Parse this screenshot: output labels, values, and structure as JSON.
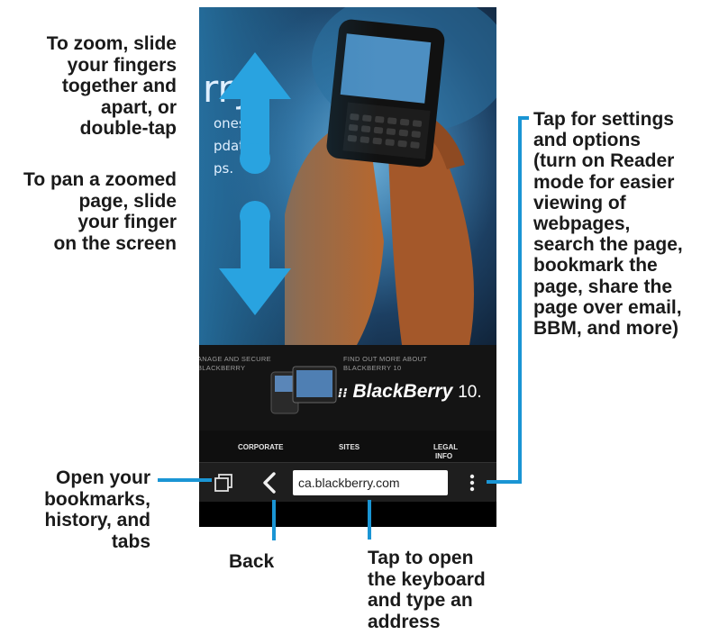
{
  "callouts": {
    "zoom": [
      "To zoom, slide",
      "your fingers",
      "together and",
      "apart, or",
      "double-tap"
    ],
    "pan": [
      "To pan a zoomed",
      "page, slide",
      "your finger",
      "on the screen"
    ],
    "settings": [
      "Tap for settings",
      "and options",
      "(turn on Reader",
      "mode for easier",
      "viewing of",
      "webpages,",
      "search the page,",
      "bookmark the",
      "page, share the",
      "page over email,",
      "BBM, and more)"
    ],
    "bookmarks": [
      "Open your",
      "bookmarks,",
      "history, and",
      "tabs"
    ],
    "back": "Back",
    "address": [
      "Tap to open",
      "the keyboard",
      "and type an",
      "address"
    ]
  },
  "hero": {
    "big_text": "rry",
    "lines": [
      "ones",
      "pdate",
      "ps."
    ]
  },
  "site": {
    "caption_left": [
      "ANAGE AND SECURE",
      "BLACKBERRY"
    ],
    "caption_right": [
      "FIND OUT MORE ABOUT",
      "BLACKBERRY 10"
    ],
    "logo_text": "BlackBerry",
    "logo_version": "10.",
    "footer_links": [
      "CORPORATE",
      "SITES",
      "LEGAL",
      "INFO"
    ]
  },
  "toolbar": {
    "url": "ca.blackberry.com",
    "tabs_icon": "tabs-icon",
    "back_icon": "chevron-left-icon",
    "menu_icon": "overflow-menu-icon"
  },
  "colors": {
    "accent": "#1a95d4",
    "arrow": "#29a3e0"
  }
}
